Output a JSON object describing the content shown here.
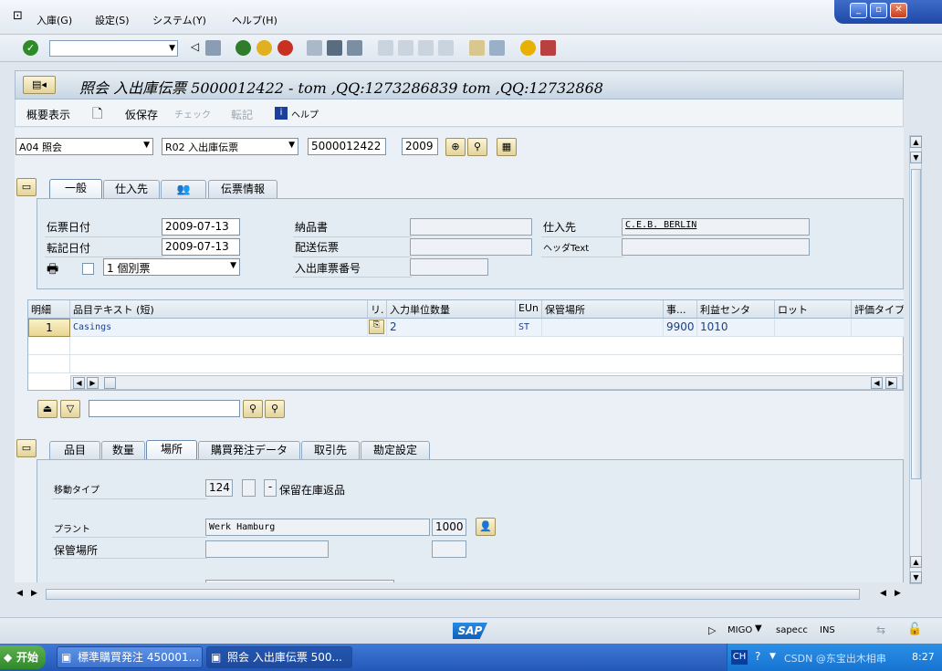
{
  "menu": {
    "items": [
      "入庫(G)",
      "設定(S)",
      "システム(Y)",
      "ヘルプ(H)"
    ]
  },
  "window_controls": [
    "_",
    "▫",
    "✕"
  ],
  "title": "照会 入出庫伝票 5000012422 - tom ,QQ:1273286839 tom ,QQ:12732868",
  "app_toolbar": {
    "overview": "概要表示",
    "hold": "仮保存",
    "check": "チェック",
    "post": "転記",
    "help": "ヘルプ"
  },
  "header": {
    "action": "A04 照会",
    "ref_doc": "R02 入出庫伝票",
    "doc_number": "5000012422",
    "year": "2009"
  },
  "header_tabs": [
    "一般",
    "仕入先",
    "",
    "伝票情報"
  ],
  "general": {
    "doc_date_label": "伝票日付",
    "doc_date": "2009-07-13",
    "post_date_label": "転記日付",
    "post_date": "2009-07-13",
    "slip_option": "1 個別票",
    "delivery_note_label": "納品書",
    "bill_of_lading_label": "配送伝票",
    "gr_slip_label": "入出庫票番号",
    "vendor_label": "仕入先",
    "vendor_value": "C.E.B. BERLIN",
    "header_text_label": "ヘッダText"
  },
  "items_table": {
    "columns": [
      "明細",
      "品目テキスト (短)",
      "リ.",
      "入力単位数量",
      "EUn",
      "保管場所",
      "事...",
      "利益センタ",
      "ロット",
      "評価タイプ"
    ],
    "rows": [
      {
        "item": "1",
        "text": "Casings",
        "qty": "2",
        "unit": "ST",
        "sloc": "",
        "plant": "9900",
        "profit": "1010",
        "batch": "",
        "val": ""
      }
    ]
  },
  "detail_tabs": [
    "品目",
    "数量",
    "場所",
    "購買発注データ",
    "取引先",
    "勘定設定"
  ],
  "detail": {
    "movement_type_label": "移動タイプ",
    "movement_type": "124",
    "return_label": "保留在庫返品",
    "return_check": "-",
    "plant_label": "プラント",
    "plant_name": "Werk Hamburg",
    "plant_code": "1000",
    "sloc_label": "保管場所"
  },
  "status": {
    "brand": "SAP",
    "transaction": "MIGO",
    "system": "sapecc",
    "mode": "INS"
  },
  "taskbar": {
    "start": "开始",
    "tasks": [
      "標準購買発注 450001...",
      "照会 入出庫伝票 500..."
    ],
    "lang": "CH",
    "clock": "8:27",
    "watermark": "CSDN @东宝出木相串"
  }
}
